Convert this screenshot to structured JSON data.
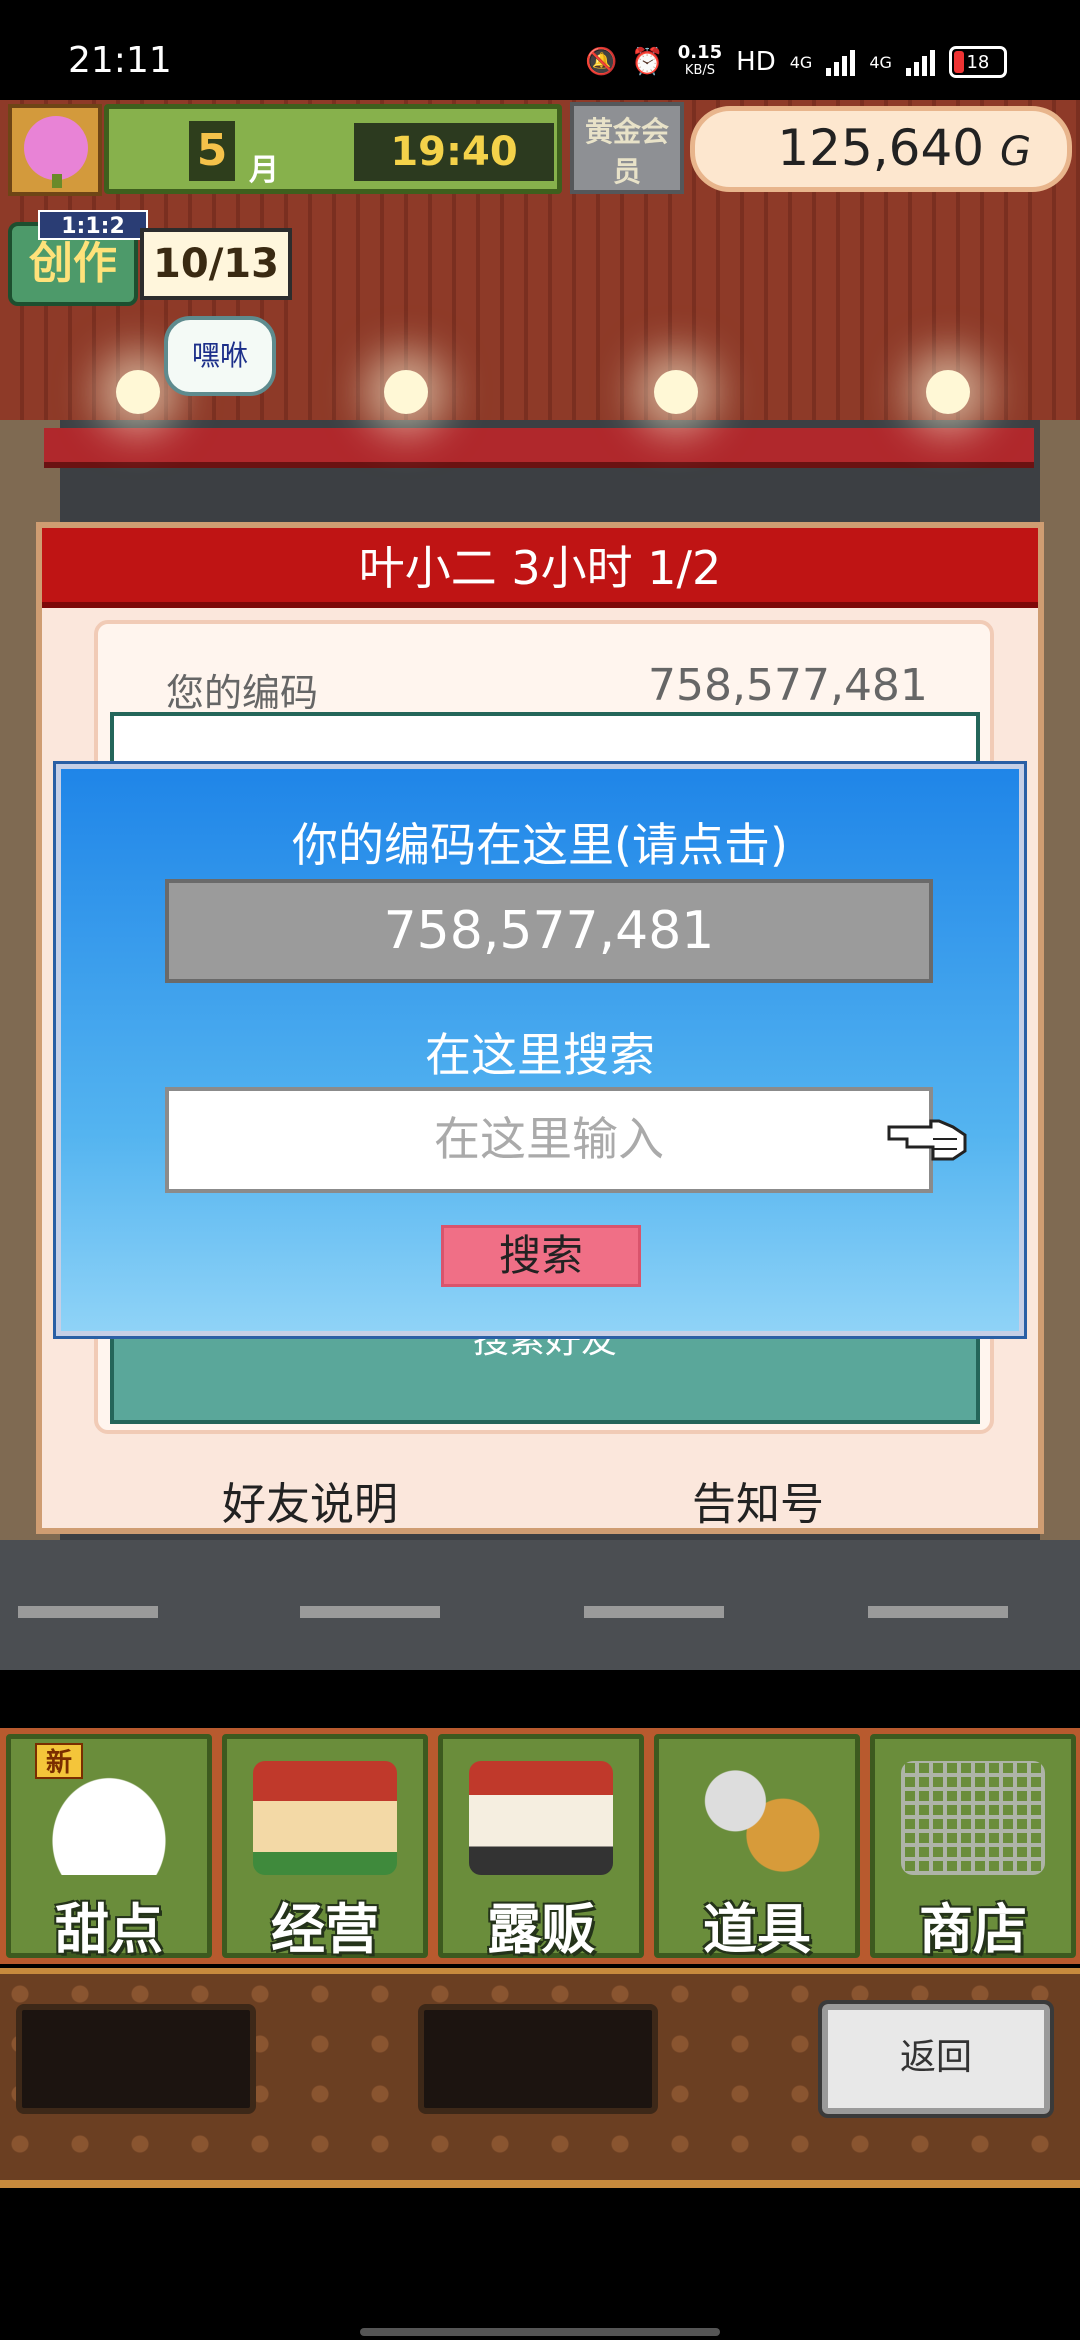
{
  "status_bar": {
    "time": "21:11",
    "speed_value": "0.15",
    "speed_unit": "KB/S",
    "network": "HD",
    "sim1": "4G",
    "sim2": "4G",
    "battery": "18"
  },
  "hud": {
    "month": "5",
    "month_label": "月",
    "clock": "19:40",
    "gold_label": "黄金会员",
    "money": "125,640",
    "money_unit": "G",
    "create_level": "1:1:2",
    "create_label": "创作",
    "create_progress": "10/13",
    "speech_bubble": "嘿咻"
  },
  "panel": {
    "title": "叶小二  3小时 1/2",
    "code_label": "您的编码",
    "code_value": "758,577,481",
    "search_friend": "搜索好友",
    "friend_help": "好友说明",
    "notice": "告知号"
  },
  "dialog": {
    "title": "你的编码在这里(请点击)",
    "code_value": "758,577,481",
    "search_label": "在这里搜索",
    "input_placeholder": "在这里输入",
    "search_button": "搜索"
  },
  "menu": {
    "new_badge": "新",
    "items": [
      {
        "label": "甜点",
        "icon": "cake-icon"
      },
      {
        "label": "经营",
        "icon": "shop-icon"
      },
      {
        "label": "露贩",
        "icon": "food-truck-icon"
      },
      {
        "label": "道具",
        "icon": "gear-bag-icon"
      },
      {
        "label": "商店",
        "icon": "shopping-cart-icon"
      }
    ]
  },
  "bottom_bar": {
    "back_button": "返回"
  }
}
